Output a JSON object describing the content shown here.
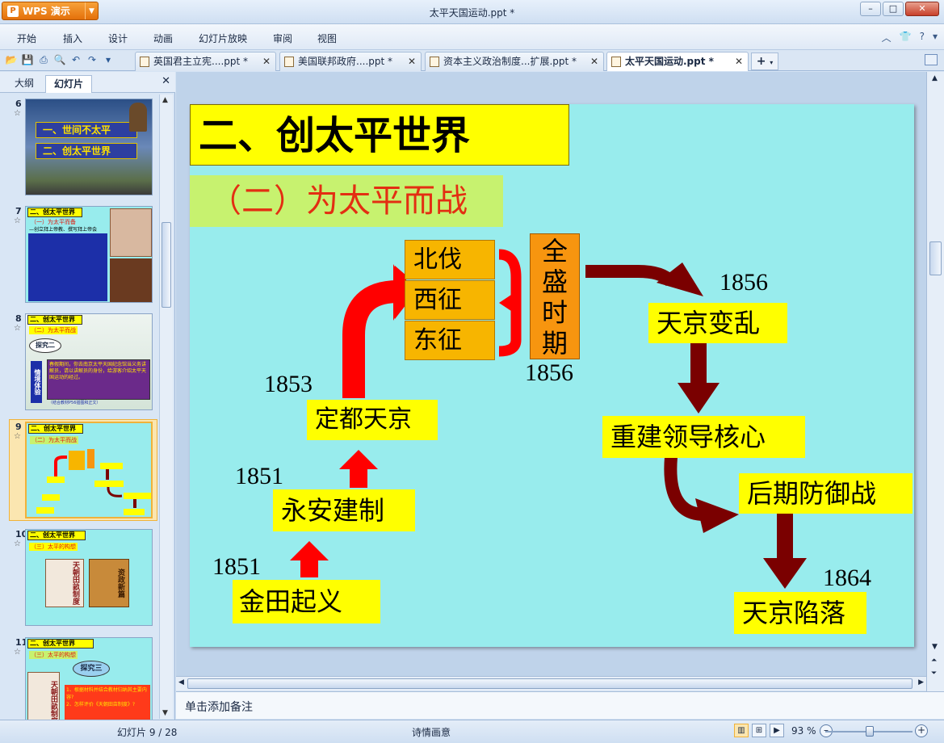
{
  "app": {
    "button_label": "WPS 演示",
    "window_title": "太平天国运动.ppt *"
  },
  "menu": {
    "items": [
      "开始",
      "插入",
      "设计",
      "动画",
      "幻灯片放映",
      "审阅",
      "视图"
    ]
  },
  "doc_tabs": [
    {
      "label": "英国君主立宪....ppt *",
      "active": false
    },
    {
      "label": "美国联邦政府....ppt *",
      "active": false
    },
    {
      "label": "资本主义政治制度...扩展.ppt *",
      "active": false
    },
    {
      "label": "太平天国运动.ppt *",
      "active": true
    }
  ],
  "left_panel": {
    "tabs": [
      "大纲",
      "幻灯片"
    ],
    "active_tab": "幻灯片",
    "thumbnails": [
      {
        "number": "6",
        "lines": [
          "一、世间不太平",
          "二、创太平世界"
        ]
      },
      {
        "number": "7",
        "title": "二、创太平世界",
        "sub": "（一）为太平而备",
        "sub2": "—创立拜上帝教、撰写拜上帝会"
      },
      {
        "number": "8",
        "title": "二、创太平世界",
        "sub": "（二）为太平而战",
        "bubble": "探究二",
        "vertical": "情境体验",
        "text": "春假期间，你去南京太平天国纪念馆当义务讲解员，请以讲解员的身份，给游客介绍太平天国运动的经过。",
        "note": "（结合教材P56插图和正文）"
      },
      {
        "number": "9",
        "title": "二、创太平世界",
        "sub": "（二）为太平而战",
        "selected": true
      },
      {
        "number": "10",
        "title": "二、创太平世界",
        "sub": "（三）太平的构想",
        "book1": "天朝田畝制度",
        "book2": "资政新篇"
      },
      {
        "number": "11",
        "title": "二、创太平世界",
        "sub": "（三）太平的构想",
        "bubble": "探究三",
        "book1": "天朝田畝制度",
        "q1": "1、根据材料并结合教材归纳其主要内容?",
        "q2": "2、怎样评价《天朝田亩制度》?"
      }
    ]
  },
  "slide": {
    "title": "二、创太平世界",
    "subtitle": "（二）为太平而战",
    "boxes": {
      "jintian": "金田起义",
      "yongan": "永安建制",
      "dingdu": "定都天京",
      "beifa": "北伐",
      "xizheng": "西征",
      "dongzheng": "东征",
      "quansheng": [
        "全",
        "盛",
        "时",
        "期"
      ],
      "bianluan": "天京变乱",
      "chongjian": "重建领导核心",
      "houqi": "后期防御战",
      "xianluo": "天京陷落"
    },
    "years": {
      "y_jintian": "1851",
      "y_yongan": "1851",
      "y_dingdu": "1853",
      "y_quansheng": "1856",
      "y_bianluan": "1856",
      "y_xianluo": "1864"
    },
    "colors": {
      "background": "#98eced",
      "title_box": "#ffff00",
      "subtitle_box": "#c7f26f",
      "subtitle_text": "#e32e12",
      "red_arrow": "#ff0000",
      "dark_arrow": "#7a0000",
      "orange_box": "#f7b500"
    }
  },
  "notes_placeholder": "单击添加备注",
  "status": {
    "slide_counter": "幻灯片 9 / 28",
    "theme": "诗情画意",
    "zoom": "93 %"
  }
}
